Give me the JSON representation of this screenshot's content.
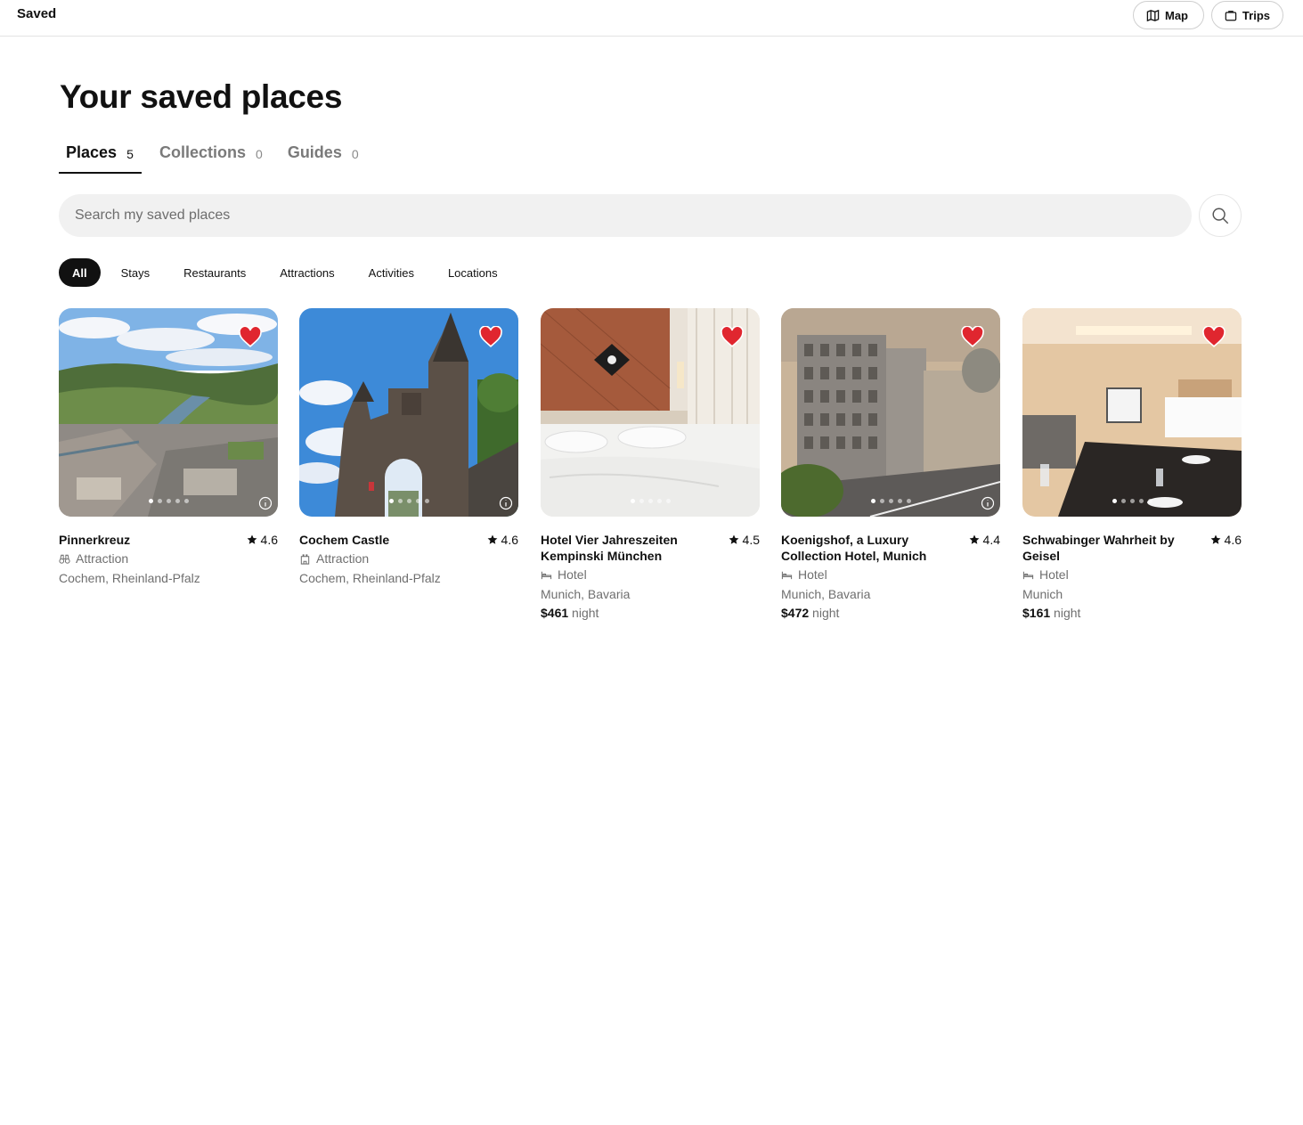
{
  "header": {
    "title": "Saved",
    "map_label": "Map",
    "trips_label": "Trips"
  },
  "page_title": "Your saved places",
  "tabs": [
    {
      "label": "Places",
      "count": "5"
    },
    {
      "label": "Collections",
      "count": "0"
    },
    {
      "label": "Guides",
      "count": "0"
    }
  ],
  "search": {
    "placeholder": "Search my saved places"
  },
  "filters": [
    "All",
    "Stays",
    "Restaurants",
    "Attractions",
    "Activities",
    "Locations"
  ],
  "cards": [
    {
      "name": "Pinnerkreuz",
      "rating": "4.6",
      "type": "Attraction",
      "location": "Cochem, Rheinland-Pfalz",
      "price": "",
      "price_unit": ""
    },
    {
      "name": "Cochem Castle",
      "rating": "4.6",
      "type": "Attraction",
      "location": "Cochem, Rheinland-Pfalz",
      "price": "",
      "price_unit": ""
    },
    {
      "name": "Hotel Vier Jahreszeiten Kempinski München",
      "rating": "4.5",
      "type": "Hotel",
      "location": "Munich, Bavaria",
      "price": "$461",
      "price_unit": "night"
    },
    {
      "name": "Koenigshof, a Luxury Collection Hotel, Munich",
      "rating": "4.4",
      "type": "Hotel",
      "location": "Munich, Bavaria",
      "price": "$472",
      "price_unit": "night"
    },
    {
      "name": "Schwabinger Wahrheit by Geisel",
      "rating": "4.6",
      "type": "Hotel",
      "location": "Munich",
      "price": "$161",
      "price_unit": "night"
    }
  ],
  "colors": {
    "heart": "#e0262f",
    "accent": "#111111",
    "search_bg": "#f1f1f1"
  }
}
